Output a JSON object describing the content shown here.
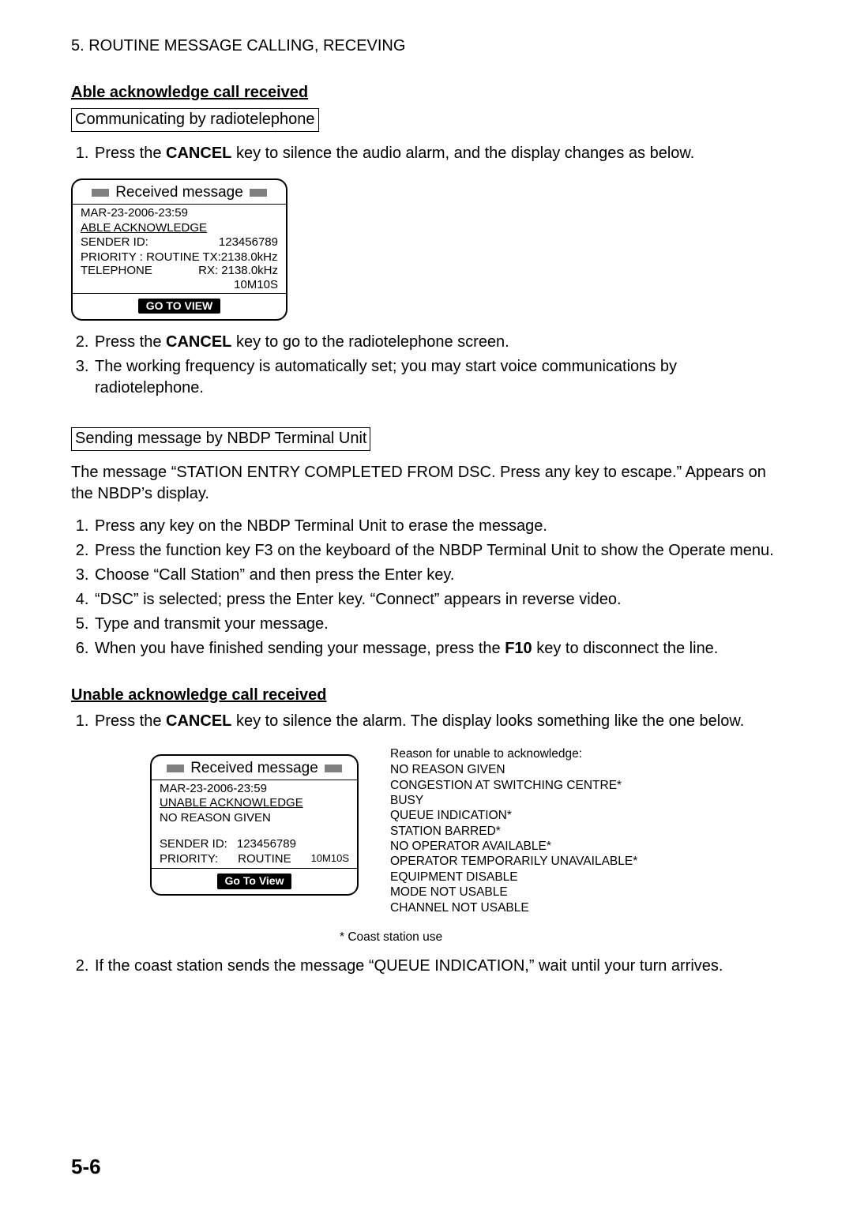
{
  "chapter_title": "5. ROUTINE MESSAGE CALLING, RECEVING",
  "section_able": {
    "heading": "Able acknowledge call received",
    "sub_radiotel": "Communicating by radiotelephone",
    "step1_pre": "Press the ",
    "step1_key": "CANCEL",
    "step1_post": " key to silence the audio alarm, and the display changes as below.",
    "step2_pre": "Press the ",
    "step2_key": "CANCEL",
    "step2_post": " key to go to the radiotelephone screen.",
    "step3": "The working frequency is automatically set; you may start voice communications by radiotelephone.",
    "sub_nbdp": "Sending message by NBDP Terminal Unit",
    "nbdp_intro": "The message “STATION ENTRY COMPLETED FROM DSC. Press any key to escape.” Appears on the NBDP’s display.",
    "nbdp_steps": {
      "s1": "Press any key on the NBDP Terminal Unit to erase the message.",
      "s2": "Press the function key F3 on the keyboard of the NBDP Terminal Unit to show the Operate menu.",
      "s3": "Choose “Call Station” and then press the Enter key.",
      "s4": "“DSC” is selected; press the Enter key. “Connect” appears in reverse video.",
      "s5": "Type and transmit your message.",
      "s6_pre": "When you have finished sending your message, press the ",
      "s6_key": "F10",
      "s6_post": " key to disconnect the line."
    }
  },
  "device1": {
    "title": "Received message",
    "timestamp": "MAR-23-2006-23:59",
    "line_ack": "ABLE ACKNOWLEDGE",
    "sender_label": "SENDER ID:",
    "sender_value": "123456789",
    "priority_line": "PRIORITY : ROUTINE  TX:2138.0kHz",
    "tel_label": "TELEPHONE",
    "rx_line": "RX: 2138.0kHz",
    "timer": "10M10S",
    "go": "GO TO VIEW"
  },
  "section_unable": {
    "heading": "Unable acknowledge call received",
    "step1_pre": "Press the ",
    "step1_key": "CANCEL",
    "step1_post": " key to silence the alarm. The display looks something like the one below.",
    "step2": "If the coast station sends the message “QUEUE INDICATION,” wait until your turn arrives."
  },
  "device2": {
    "title": "Received message",
    "timestamp": "MAR-23-2006-23:59",
    "line_ack": "UNABLE ACKNOWLEDGE",
    "reason": "NO REASON GIVEN",
    "sender_label": "SENDER ID:",
    "sender_value": "123456789",
    "priority_label": "PRIORITY:",
    "priority_value": "ROUTINE",
    "timer": "10M10S",
    "go": "Go To View"
  },
  "reasons": {
    "header": "Reason for unable to acknowledge:",
    "r1": "NO REASON GIVEN",
    "r2": "CONGESTION AT SWITCHING CENTRE*",
    "r3": "BUSY",
    "r4": "QUEUE INDICATION*",
    "r5": "STATION BARRED*",
    "r6": "NO OPERATOR AVAILABLE*",
    "r7": "OPERATOR TEMPORARILY UNAVAILABLE*",
    "r8": "EQUIPMENT DISABLE",
    "r9": "MODE NOT USABLE",
    "r10": "CHANNEL NOT USABLE",
    "footnote": "* Coast station use"
  },
  "page_number": "5-6"
}
